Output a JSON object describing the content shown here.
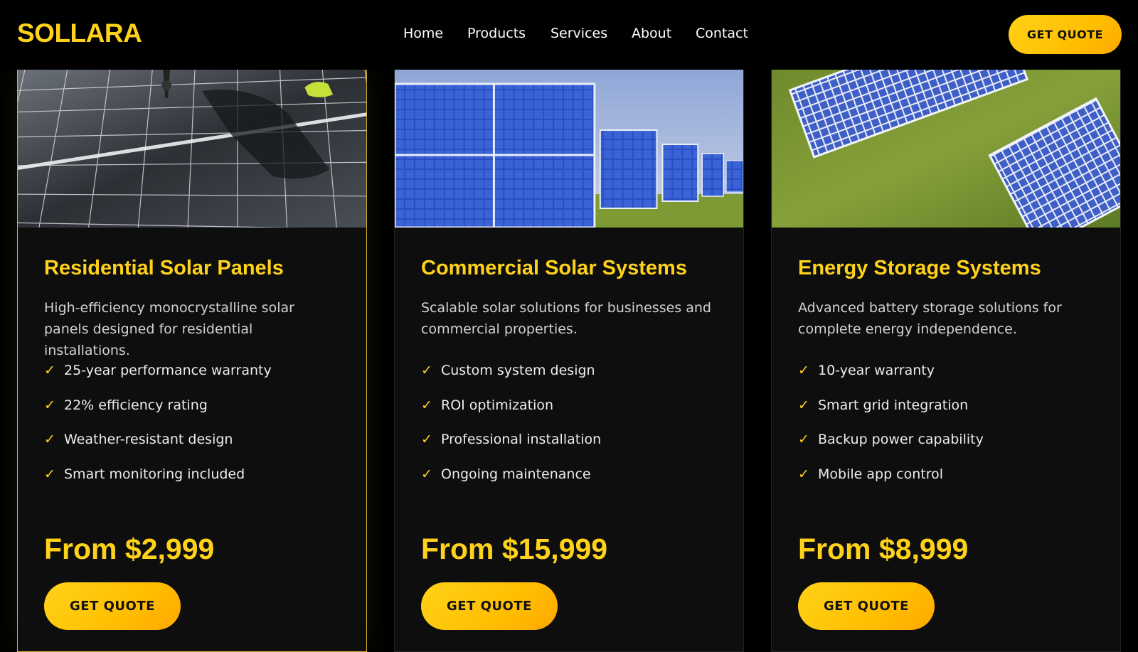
{
  "brand": {
    "name": "SOLLARA",
    "accent": "#ffd21a",
    "background": "#000000"
  },
  "nav": {
    "items": [
      {
        "label": "Home"
      },
      {
        "label": "Products"
      },
      {
        "label": "Services"
      },
      {
        "label": "About"
      },
      {
        "label": "Contact"
      }
    ]
  },
  "header": {
    "cta_label": "GET QUOTE"
  },
  "products": [
    {
      "title": "Residential Solar Panels",
      "description": "High-efficiency monocrystalline solar panels designed for residential installations.",
      "features": [
        "25-year performance warranty",
        "22% efficiency rating",
        "Weather-resistant design",
        "Smart monitoring included"
      ],
      "price": "From $2,999",
      "cta_label": "GET QUOTE",
      "image_alt": "solar panel installation close-up"
    },
    {
      "title": "Commercial Solar Systems",
      "description": "Scalable solar solutions for businesses and commercial properties.",
      "features": [
        "Custom system design",
        "ROI optimization",
        "Professional installation",
        "Ongoing maintenance"
      ],
      "price": "From $15,999",
      "cta_label": "GET QUOTE",
      "image_alt": "rows of solar panels in a field"
    },
    {
      "title": "Energy Storage Systems",
      "description": "Advanced battery storage solutions for complete energy independence.",
      "features": [
        "10-year warranty",
        "Smart grid integration",
        "Backup power capability",
        "Mobile app control"
      ],
      "price": "From $8,999",
      "cta_label": "GET QUOTE",
      "image_alt": "aerial view of solar panels on grass"
    }
  ],
  "check_icon": "✓"
}
